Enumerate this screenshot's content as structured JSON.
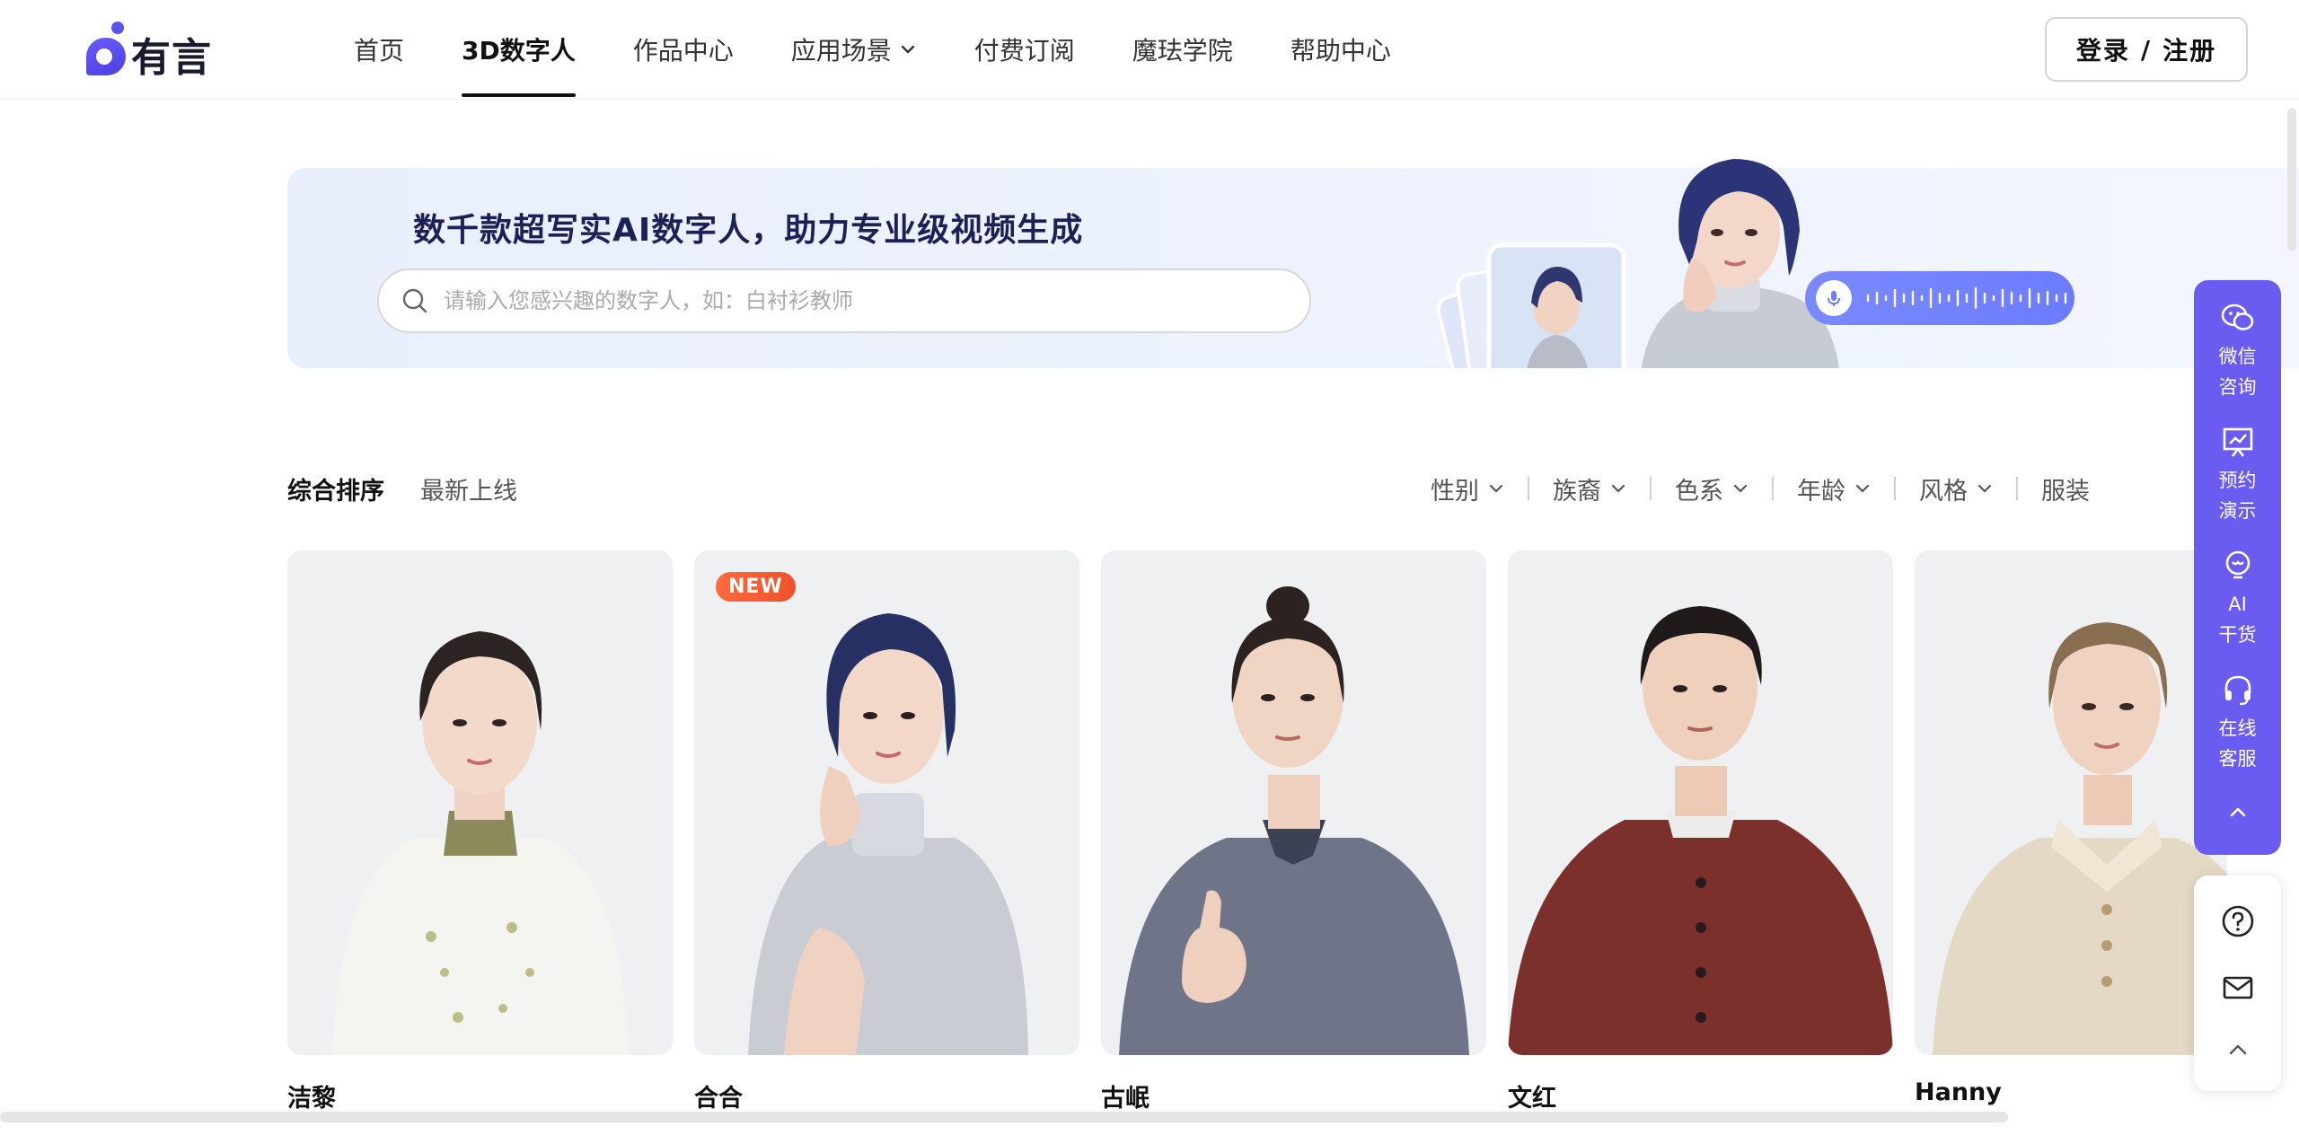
{
  "brand": {
    "name": "有言",
    "accent": "#6a5cf0"
  },
  "nav": {
    "items": [
      {
        "label": "首页",
        "active": false
      },
      {
        "label": "3D数字人",
        "active": true
      },
      {
        "label": "作品中心",
        "active": false
      },
      {
        "label": "应用场景",
        "active": false,
        "dropdown": true
      },
      {
        "label": "付费订阅",
        "active": false
      },
      {
        "label": "魔珐学院",
        "active": false
      },
      {
        "label": "帮助中心",
        "active": false
      }
    ],
    "login": "登录",
    "separator": "/",
    "register": "注册"
  },
  "banner": {
    "title": "数千款超写实AI数字人，助力专业级视频生成",
    "search_placeholder": "请输入您感兴趣的数字人，如：白衬衫教师"
  },
  "sort": {
    "options": [
      {
        "label": "综合排序",
        "active": true
      },
      {
        "label": "最新上线",
        "active": false
      }
    ]
  },
  "filters": [
    "性别",
    "族裔",
    "色系",
    "年龄",
    "风格",
    "服装"
  ],
  "cards": [
    {
      "name": "洁黎",
      "badge": "",
      "bg": "#eef0f2"
    },
    {
      "name": "合合",
      "badge": "NEW",
      "bg": "#eef0f2"
    },
    {
      "name": "古岷",
      "badge": "",
      "bg": "#eef0f2"
    },
    {
      "name": "文红",
      "badge": "",
      "bg": "#eef0f2"
    },
    {
      "name": "Hanny",
      "badge": "",
      "bg": "#eef0f2"
    }
  ],
  "float_panel": {
    "items": [
      {
        "icon": "wechat-icon",
        "label": "微信\n咨询"
      },
      {
        "icon": "presentation-icon",
        "label": "预约\n演示"
      },
      {
        "icon": "bulb-icon",
        "label": "AI\n干货"
      },
      {
        "icon": "headset-icon",
        "label": "在线\n客服"
      }
    ]
  }
}
